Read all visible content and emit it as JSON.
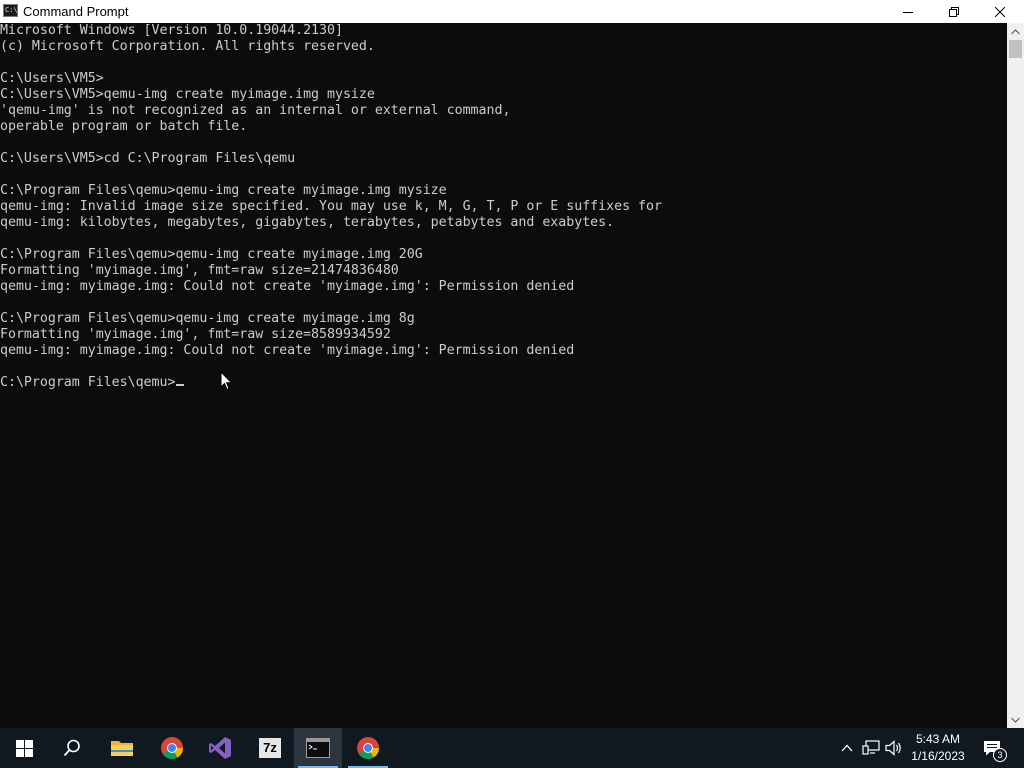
{
  "window": {
    "title": "Command Prompt",
    "icon_label": "C:\\"
  },
  "console": {
    "lines": [
      "Microsoft Windows [Version 10.0.19044.2130]",
      "(c) Microsoft Corporation. All rights reserved.",
      "",
      "C:\\Users\\VM5>",
      "C:\\Users\\VM5>qemu-img create myimage.img mysize",
      "'qemu-img' is not recognized as an internal or external command,",
      "operable program or batch file.",
      "",
      "C:\\Users\\VM5>cd C:\\Program Files\\qemu",
      "",
      "C:\\Program Files\\qemu>qemu-img create myimage.img mysize",
      "qemu-img: Invalid image size specified. You may use k, M, G, T, P or E suffixes for",
      "qemu-img: kilobytes, megabytes, gigabytes, terabytes, petabytes and exabytes.",
      "",
      "C:\\Program Files\\qemu>qemu-img create myimage.img 20G",
      "Formatting 'myimage.img', fmt=raw size=21474836480",
      "qemu-img: myimage.img: Could not create 'myimage.img': Permission denied",
      "",
      "C:\\Program Files\\qemu>qemu-img create myimage.img 8g",
      "Formatting 'myimage.img', fmt=raw size=8589934592",
      "qemu-img: myimage.img: Could not create 'myimage.img': Permission denied",
      "",
      "C:\\Program Files\\qemu>"
    ],
    "text_color": "#cccccc",
    "background": "#0c0c0c"
  },
  "taskbar": {
    "items": [
      {
        "name": "start-button",
        "icon": "windows-logo-icon"
      },
      {
        "name": "search-button",
        "icon": "search-icon"
      },
      {
        "name": "file-explorer-button",
        "icon": "folder-icon"
      },
      {
        "name": "chrome-button",
        "icon": "chrome-icon"
      },
      {
        "name": "visual-studio-button",
        "icon": "visual-studio-icon"
      },
      {
        "name": "7zip-button",
        "icon": "7zip-icon",
        "label": "7z"
      },
      {
        "name": "command-prompt-button",
        "icon": "terminal-icon",
        "active": true
      },
      {
        "name": "chrome-profile-button",
        "icon": "chrome-icon"
      }
    ],
    "clock": {
      "time": "5:43 AM",
      "date": "1/16/2023"
    },
    "notification_count": "3"
  }
}
